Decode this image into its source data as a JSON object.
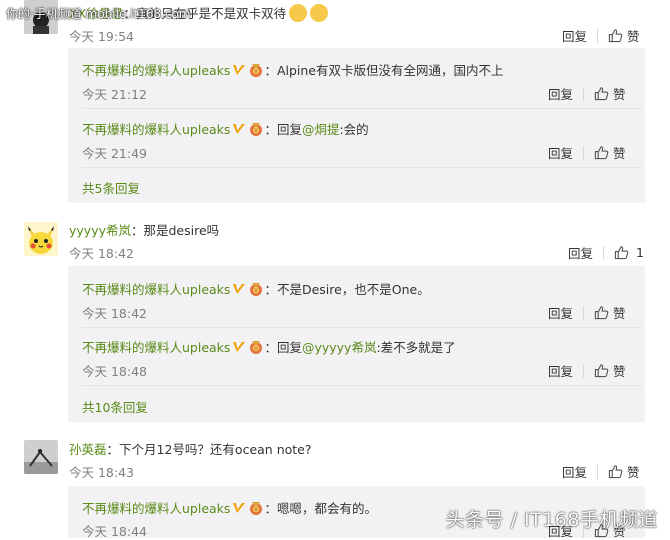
{
  "watermark_site": "你的·手机频道 mobile.it168.com",
  "watermark_bottom": "头条号 / IT168手机频道",
  "accent_color": "#5b8a18",
  "comments": [
    {
      "user": "XX徐悬悬",
      "text": "：真的只在乎是不是双卡双待",
      "time": "今天 19:54",
      "reply_label": "回复",
      "like_label": "赞",
      "replies": [
        {
          "user": "不再爆料的爆料人upleaks",
          "text": "：Alpine有双卡版但没有全网通，国内不上",
          "time": "今天 21:12",
          "reply_label": "回复",
          "like_label": "赞"
        },
        {
          "user": "不再爆料的爆料人upleaks",
          "prefix": "：回复",
          "mention": "@烔提",
          "text": ":会的",
          "time": "今天 21:49",
          "reply_label": "回复",
          "like_label": "赞"
        }
      ],
      "more_label": "共5条回复"
    },
    {
      "user": "yyyyy希岚",
      "text": "：那是desire吗",
      "time": "今天 18:42",
      "reply_label": "回复",
      "like_count": "1",
      "replies": [
        {
          "user": "不再爆料的爆料人upleaks",
          "text": "：不是Desire，也不是One。",
          "time": "今天 18:42",
          "reply_label": "回复",
          "like_label": "赞"
        },
        {
          "user": "不再爆料的爆料人upleaks",
          "prefix": "：回复",
          "mention": "@yyyyy希岚",
          "text": ":差不多就是了",
          "time": "今天 18:48",
          "reply_label": "回复",
          "like_label": "赞"
        }
      ],
      "more_label": "共10条回复"
    },
    {
      "user": "孙英磊",
      "text": "：下个月12号吗？还有ocean note?",
      "time": "今天 18:43",
      "reply_label": "回复",
      "like_label": "赞",
      "replies": [
        {
          "user": "不再爆料的爆料人upleaks",
          "text": "：嗯嗯，都会有的。",
          "time": "今天 18:44",
          "reply_label": "回复",
          "like_label": "赞"
        }
      ]
    }
  ]
}
